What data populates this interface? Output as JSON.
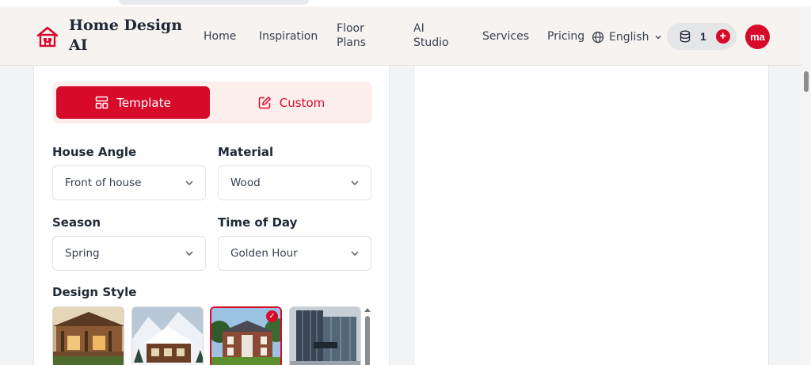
{
  "brand": {
    "name": "Home Design AI",
    "accent_color": "#d80a2a",
    "logo_icon": "house-logo-icon"
  },
  "nav": {
    "items": [
      {
        "label": "Home"
      },
      {
        "label": "Inspiration"
      },
      {
        "label": "Floor Plans"
      },
      {
        "label": "AI Studio"
      },
      {
        "label": "Services"
      },
      {
        "label": "Pricing"
      }
    ],
    "language": {
      "label": "English",
      "icon": "globe-icon"
    },
    "credits": {
      "count": "1",
      "icon": "database-icon",
      "add_label": "+"
    },
    "avatar": {
      "initials": "ma"
    }
  },
  "mode_tabs": [
    {
      "label": "Template",
      "icon": "layout-icon",
      "active": true
    },
    {
      "label": "Custom",
      "icon": "edit-icon",
      "active": false
    }
  ],
  "fields": {
    "house_angle": {
      "label": "House Angle",
      "value": "Front of house"
    },
    "material": {
      "label": "Material",
      "value": "Wood"
    },
    "season": {
      "label": "Season",
      "value": "Spring"
    },
    "time_of_day": {
      "label": "Time of Day",
      "value": "Golden Hour"
    }
  },
  "design_style": {
    "label": "Design Style",
    "styles": [
      {
        "icon": "wooden-porch-house-thumbnail",
        "selected": false
      },
      {
        "icon": "alpine-chalet-thumbnail",
        "selected": false
      },
      {
        "icon": "colonial-brick-house-thumbnail",
        "selected": true
      },
      {
        "icon": "modern-glass-building-thumbnail",
        "selected": false
      }
    ],
    "check_icon": "checkmark-icon"
  }
}
